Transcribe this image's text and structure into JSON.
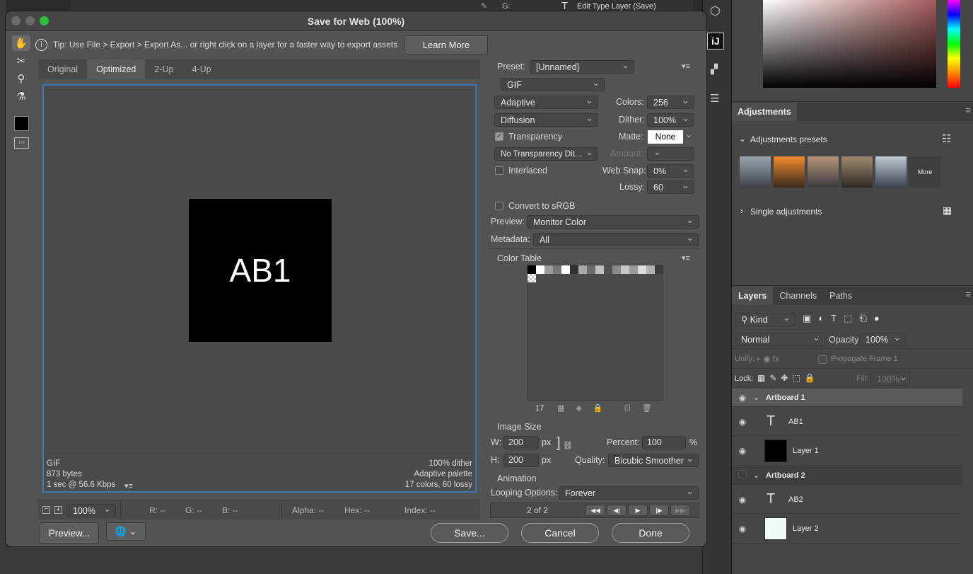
{
  "dialog": {
    "title": "Save for Web (100%)",
    "tip": "Tip: Use File > Export > Export As...  or right click on a layer for a faster way to export assets",
    "learn_more": "Learn More",
    "tabs": [
      "Original",
      "Optimized",
      "2-Up",
      "4-Up"
    ],
    "artwork_text": "AB1",
    "info_left": [
      "GIF",
      "873 bytes",
      "1 sec @ 56.6 Kbps"
    ],
    "info_right": [
      "100% dither",
      "Adaptive palette",
      "17 colors, 60 lossy"
    ],
    "zoom": "100%",
    "readouts": {
      "r": "R: --",
      "g": "G: --",
      "b": "B: --",
      "alpha": "Alpha: --",
      "hex": "Hex: --",
      "index": "Index: --"
    },
    "buttons": {
      "preview": "Preview...",
      "save": "Save...",
      "cancel": "Cancel",
      "done": "Done"
    }
  },
  "settings": {
    "preset_label": "Preset:",
    "preset": "[Unnamed]",
    "format": "GIF",
    "palette": "Adaptive",
    "colors_label": "Colors:",
    "colors": "256",
    "dither_algo": "Diffusion",
    "dither_label": "Dither:",
    "dither": "100%",
    "transparency_label": "Transparency",
    "transparency_checked": true,
    "matte_label": "Matte:",
    "matte": "None",
    "transparency_dither": "No Transparency Dit...",
    "amount_label": "Amount:",
    "interlaced_label": "Interlaced",
    "websnap_label": "Web Snap:",
    "websnap": "0%",
    "lossy_label": "Lossy:",
    "lossy": "60",
    "srgb_label": "Convert to sRGB",
    "preview_label": "Preview:",
    "preview": "Monitor Color",
    "metadata_label": "Metadata:",
    "metadata": "All",
    "color_table_label": "Color Table",
    "color_count": "17",
    "swatches": [
      "#000000",
      "#ffffff",
      "#9b9b9b",
      "#777777",
      "#ffffff",
      "#323232",
      "#a8a8a8",
      "#6b6b6b",
      "#bfbfbf",
      "#505050",
      "#8a8a8a",
      "#c8c8c8",
      "#9a9a9a",
      "#dcdcdc",
      "#b2b2b2",
      "#3c3c3c"
    ],
    "image_size_label": "Image Size",
    "w_label": "W:",
    "w": "200",
    "h_label": "H:",
    "h": "200",
    "px": "px",
    "percent_label": "Percent:",
    "percent": "100",
    "percent_unit": "%",
    "quality_label": "Quality:",
    "quality": "Bicubic Smoother",
    "animation_label": "Animation",
    "looping_label": "Looping Options:",
    "looping": "Forever",
    "frame": "2 of 2"
  },
  "history": {
    "item": "Edit Type Layer (Save)",
    "g_label": "G:"
  },
  "adjustments": {
    "tab": "Adjustments",
    "presets_label": "Adjustments presets",
    "more": "More",
    "single": "Single adjustments"
  },
  "layers": {
    "tabs": [
      "Layers",
      "Channels",
      "Paths"
    ],
    "kind": "Kind",
    "blend": "Normal",
    "opacity_label": "Opacity:",
    "opacity": "100%",
    "unify_label": "Unify:",
    "propagate": "Propagate Frame 1",
    "lock_label": "Lock:",
    "fill_label": "Fill:",
    "fill": "100%",
    "rows": [
      {
        "name": "Artboard 1",
        "type": "artboard",
        "visible": true
      },
      {
        "name": "AB1",
        "type": "text",
        "visible": true
      },
      {
        "name": "Layer 1",
        "type": "pixel",
        "visible": true
      },
      {
        "name": "Artboard 2",
        "type": "artboard",
        "visible": false
      },
      {
        "name": "AB2",
        "type": "text",
        "visible": true
      },
      {
        "name": "Layer 2",
        "type": "pixel",
        "visible": true
      }
    ]
  }
}
